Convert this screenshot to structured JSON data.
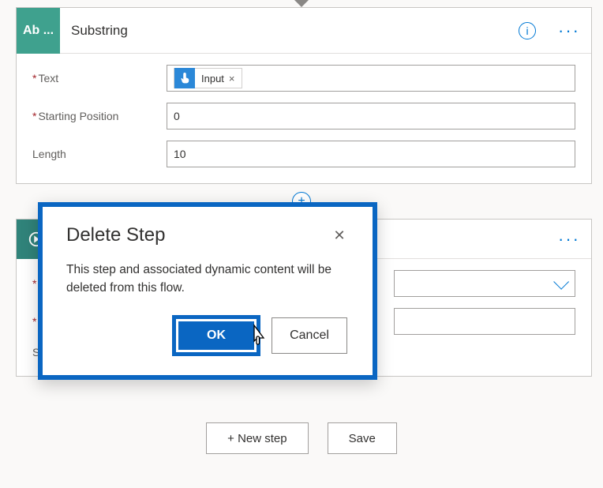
{
  "substring_card": {
    "badge": "Ab ...",
    "title": "Substring",
    "info_symbol": "i",
    "more_symbol": "···",
    "fields": {
      "text_label": "Text",
      "starting_label": "Starting Position",
      "length_label": "Length",
      "token_name": "Input",
      "token_remove": "×",
      "starting_value": "0",
      "length_value": "10"
    }
  },
  "add_symbol": "+",
  "second_card": {
    "more_symbol": "···",
    "ghost_label_marker": "*",
    "ghost_s": "S"
  },
  "dialog": {
    "title": "Delete Step",
    "close_symbol": "✕",
    "body": "This step and associated dynamic content will be deleted from this flow.",
    "ok_label": "OK",
    "cancel_label": "Cancel"
  },
  "bottom": {
    "new_step": "+ New step",
    "save": "Save"
  }
}
